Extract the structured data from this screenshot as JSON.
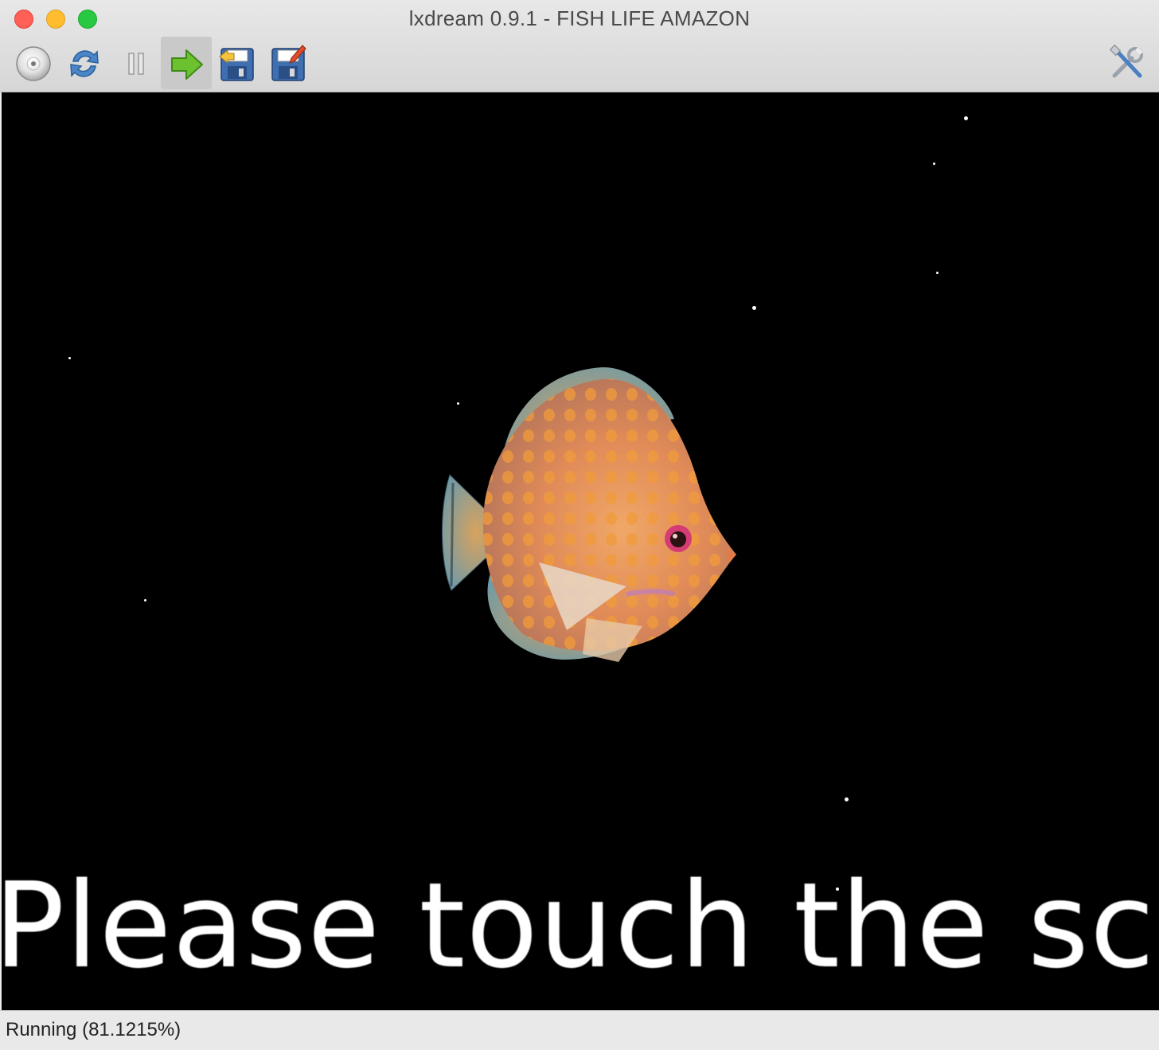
{
  "window": {
    "title": "lxdream 0.9.1 - FISH LIFE AMAZON"
  },
  "toolbar": {
    "buttons": [
      {
        "name": "disc-icon",
        "label": "Load disc"
      },
      {
        "name": "reset-icon",
        "label": "Reset"
      },
      {
        "name": "pause-icon",
        "label": "Pause"
      },
      {
        "name": "run-icon",
        "label": "Run",
        "active": true
      },
      {
        "name": "load-state-icon",
        "label": "Load state"
      },
      {
        "name": "save-state-icon",
        "label": "Save state"
      },
      {
        "name": "settings-icon",
        "label": "Settings"
      }
    ]
  },
  "game": {
    "prompt_text": "Please touch the screen"
  },
  "status": {
    "text": "Running (81.1215%)"
  },
  "colors": {
    "screen_bg": "#000000",
    "run_arrow": "#6cc22e",
    "fish_body": "#e8934a"
  }
}
